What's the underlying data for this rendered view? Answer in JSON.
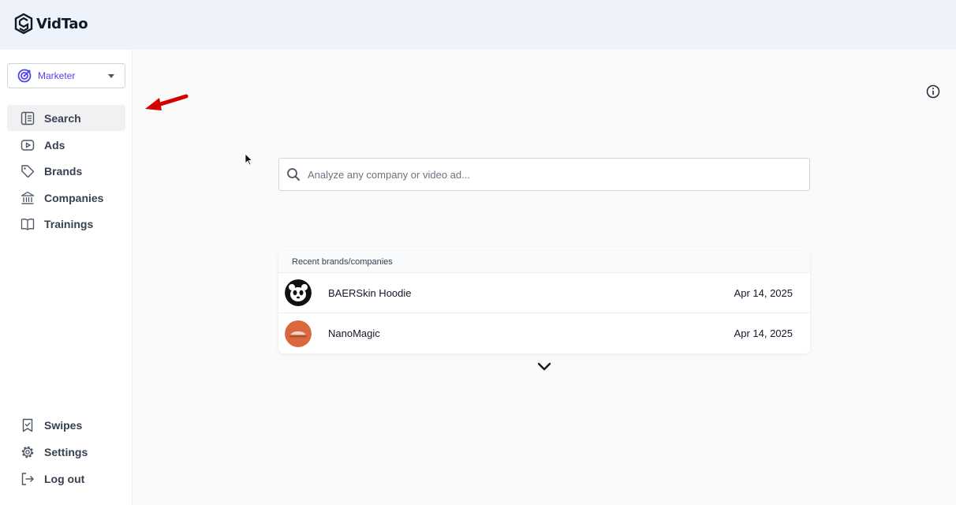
{
  "app": {
    "name": "VidTao"
  },
  "role_selector": {
    "value": "Marketer"
  },
  "nav": {
    "primary": [
      {
        "label": "Search",
        "icon": "search-list-icon",
        "active": true
      },
      {
        "label": "Ads",
        "icon": "play-icon"
      },
      {
        "label": "Brands",
        "icon": "tag-icon"
      },
      {
        "label": "Companies",
        "icon": "bank-icon"
      },
      {
        "label": "Trainings",
        "icon": "book-icon"
      }
    ],
    "secondary": [
      {
        "label": "Swipes",
        "icon": "bookmark-check-icon"
      },
      {
        "label": "Settings",
        "icon": "gear-icon"
      },
      {
        "label": "Log out",
        "icon": "logout-icon"
      }
    ]
  },
  "search": {
    "placeholder": "Analyze any company or video ad..."
  },
  "recent": {
    "header": "Recent brands/companies",
    "items": [
      {
        "name": "BAERSkin Hoodie",
        "date": "Apr 14, 2025",
        "avatar": "panda-logo"
      },
      {
        "name": "NanoMagic",
        "date": "Apr 14, 2025",
        "avatar": "car-logo"
      }
    ]
  },
  "colors": {
    "accent": "#4f46e5",
    "topbar": "#eef2fb",
    "annotation_arrow": "#d40000"
  }
}
